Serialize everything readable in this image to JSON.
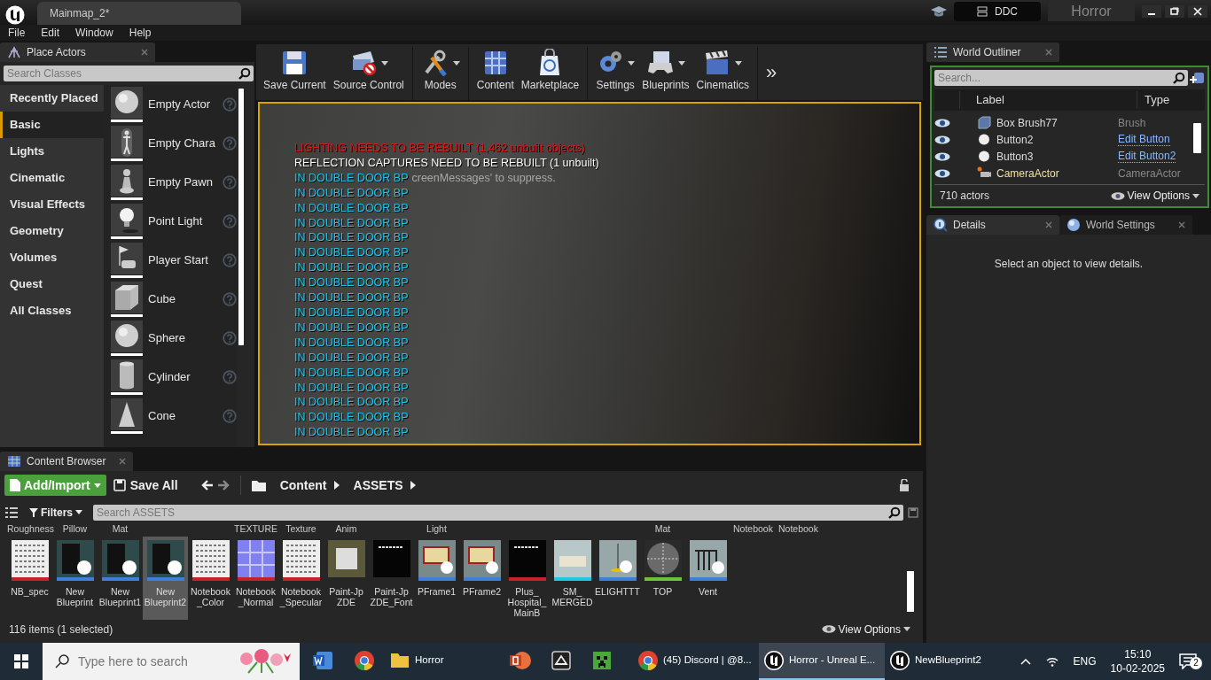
{
  "title_bar": {
    "tab": "Mainmap_2*",
    "ddc": "DDC",
    "project": "Horror"
  },
  "menu": [
    "File",
    "Edit",
    "Window",
    "Help"
  ],
  "place_actors": {
    "tab": "Place Actors",
    "search": {
      "placeholder": "Search Classes"
    },
    "categories": [
      {
        "label": "Recently Placed",
        "selected": false
      },
      {
        "label": "Basic",
        "selected": true
      },
      {
        "label": "Lights",
        "selected": false
      },
      {
        "label": "Cinematic",
        "selected": false
      },
      {
        "label": "Visual Effects",
        "selected": false
      },
      {
        "label": "Geometry",
        "selected": false
      },
      {
        "label": "Volumes",
        "selected": false
      },
      {
        "label": "Quest",
        "selected": false
      },
      {
        "label": "All Classes",
        "selected": false
      }
    ],
    "items": [
      {
        "label": "Empty Actor",
        "kind": "sphere"
      },
      {
        "label": "Empty Chara",
        "kind": "figure"
      },
      {
        "label": "Empty Pawn",
        "kind": "pawn"
      },
      {
        "label": "Point Light",
        "kind": "bulb"
      },
      {
        "label": "Player Start",
        "kind": "flag"
      },
      {
        "label": "Cube",
        "kind": "cube"
      },
      {
        "label": "Sphere",
        "kind": "sphere"
      },
      {
        "label": "Cylinder",
        "kind": "cylinder"
      },
      {
        "label": "Cone",
        "kind": "cone"
      }
    ]
  },
  "toolbar": {
    "buttons": [
      {
        "label": "Save Current",
        "kind": "save",
        "dropdown": false
      },
      {
        "label": "Source Control",
        "kind": "source",
        "dropdown": true
      },
      {
        "label": "Modes",
        "kind": "modes",
        "dropdown": true
      },
      {
        "label": "Content",
        "kind": "content",
        "dropdown": false
      },
      {
        "label": "Marketplace",
        "kind": "market",
        "dropdown": false
      },
      {
        "label": "Settings",
        "kind": "settings",
        "dropdown": true
      },
      {
        "label": "Blueprints",
        "kind": "blueprints",
        "dropdown": true
      },
      {
        "label": "Cinematics",
        "kind": "cinematics",
        "dropdown": true
      }
    ],
    "overflow": "»"
  },
  "viewport": {
    "warnings": [
      {
        "text": "LIGHTING NEEDS TO BE REBUILT (1,462 unbuilt objects)",
        "color": "#e01818"
      },
      {
        "text": "REFLECTION CAPTURES NEED TO BE REBUILT (1 unbuilt)",
        "color": "#ffffff"
      }
    ],
    "hint": "creenMessages' to suppress.",
    "messages": [
      "IN DOUBLE DOOR BP",
      "IN DOUBLE DOOR BP",
      "IN DOUBLE DOOR BP",
      "IN DOUBLE DOOR BP",
      "IN DOUBLE DOOR BP",
      "IN DOUBLE DOOR BP",
      "IN DOUBLE DOOR BP",
      "IN DOUBLE DOOR BP",
      "IN DOUBLE DOOR BP",
      "IN DOUBLE DOOR BP",
      "IN DOUBLE DOOR BP",
      "IN DOUBLE DOOR BP",
      "IN DOUBLE DOOR BP",
      "IN DOUBLE DOOR BP",
      "IN DOUBLE DOOR BP",
      "IN DOUBLE DOOR BP",
      "IN DOUBLE DOOR BP",
      "IN DOUBLE DOOR BP"
    ]
  },
  "world_outliner": {
    "tab": "World Outliner",
    "search": {
      "placeholder": "Search..."
    },
    "columns": [
      "Label",
      "Type"
    ],
    "rows": [
      {
        "label": "Box Brush77",
        "type": "Brush",
        "kind": "brush",
        "type_link": false,
        "highlighted": false
      },
      {
        "label": "Button2",
        "type": "Edit Button",
        "kind": "sphere",
        "type_link": true,
        "highlighted": false
      },
      {
        "label": "Button3",
        "type": "Edit Button2",
        "kind": "sphere",
        "type_link": true,
        "highlighted": false
      },
      {
        "label": "CameraActor",
        "type": "CameraActor",
        "kind": "camera",
        "type_link": false,
        "highlighted": true
      }
    ],
    "count": "710 actors",
    "view_options": "View Options"
  },
  "details": {
    "tabs": [
      {
        "label": "Details",
        "kind": "details",
        "selected": true
      },
      {
        "label": "World Settings",
        "kind": "world",
        "selected": false
      }
    ],
    "message": "Select an object to view details."
  },
  "content_browser": {
    "tab": "Content Browser",
    "add_import": "Add/Import",
    "save_all": "Save All",
    "path": [
      "Content",
      "ASSETS"
    ],
    "filters": "Filters",
    "search": {
      "placeholder": "Search ASSETS"
    },
    "upper_row": [
      {
        "kind": "label",
        "label": "Roughness"
      },
      {
        "kind": "label",
        "label": "Pillow"
      },
      {
        "kind": "label",
        "label": "Mat"
      },
      {
        "kind": "hidden"
      },
      {
        "kind": "hidden"
      },
      {
        "kind": "label",
        "label": "TEXTURE"
      },
      {
        "kind": "label",
        "label": "Texture"
      },
      {
        "kind": "label",
        "label": "Anim"
      },
      {
        "kind": "hidden"
      },
      {
        "kind": "label",
        "label": "Light"
      },
      {
        "kind": "hidden"
      },
      {
        "kind": "hidden"
      },
      {
        "kind": "hidden"
      },
      {
        "kind": "hidden"
      },
      {
        "kind": "label",
        "label": "Mat"
      },
      {
        "kind": "hidden"
      },
      {
        "kind": "label",
        "label": "Notebook"
      },
      {
        "kind": "label",
        "label": "Notebook"
      }
    ],
    "assets": [
      {
        "label": "NB_spec",
        "kind": "texture",
        "color": "#c4222a",
        "selected": false
      },
      {
        "label": "New Blueprint",
        "kind": "blueprint",
        "color": "#3d7fd9",
        "selected": false
      },
      {
        "label": "New Blueprint1",
        "kind": "blueprint",
        "color": "#3d7fd9",
        "selected": false
      },
      {
        "label": "New Blueprint2",
        "kind": "blueprint",
        "color": "#3d7fd9",
        "selected": true
      },
      {
        "label": "Notebook _Color",
        "kind": "texture",
        "color": "#c4222a",
        "selected": false
      },
      {
        "label": "Notebook _Normal",
        "kind": "normal",
        "color": "#c4222a",
        "selected": false
      },
      {
        "label": "Notebook _Specular",
        "kind": "texture",
        "color": "#c4222a",
        "selected": false
      },
      {
        "label": "Paint-Jp ZDE",
        "kind": "fontface",
        "selected": false
      },
      {
        "label": "Paint-Jp ZDE_Font",
        "kind": "font",
        "selected": false
      },
      {
        "label": "PFrame1",
        "kind": "frame",
        "color": "#3d7fd9",
        "selected": false
      },
      {
        "label": "PFrame2",
        "kind": "frame",
        "color": "#3d7fd9",
        "selected": false
      },
      {
        "label": "Plus_ Hospital_ MainB",
        "kind": "font",
        "color": "#c4222a",
        "selected": false
      },
      {
        "label": "SM_ MERGED",
        "kind": "mesh",
        "color": "#1ec8e0",
        "selected": false
      },
      {
        "label": "ELIGHTTT",
        "kind": "lamp",
        "color": "#3d7fd9",
        "selected": false
      },
      {
        "label": "TOP",
        "kind": "material",
        "color": "#6cc33a",
        "selected": false
      },
      {
        "label": "Vent",
        "kind": "vent",
        "color": "#3d7fd9",
        "selected": false
      }
    ],
    "status": "116 items (1 selected)",
    "view_options": "View Options"
  },
  "taskbar": {
    "search": {
      "placeholder": "Type here to search"
    },
    "apps": [
      {
        "kind": "word",
        "selected": false
      },
      {
        "kind": "chrome",
        "selected": false
      },
      {
        "kind": "folder",
        "label": "Horror",
        "selected": false
      },
      {
        "kind": "powerpoint",
        "selected": false
      },
      {
        "kind": "app",
        "selected": false
      },
      {
        "kind": "minecraft",
        "selected": false
      },
      {
        "kind": "chrome",
        "label": "(45) Discord | @8...",
        "selected": false
      },
      {
        "kind": "unreal",
        "label": "Horror - Unreal E...",
        "selected": true
      },
      {
        "kind": "unreal",
        "label": "NewBlueprint2",
        "selected": false
      }
    ],
    "language": "ENG",
    "time": "15:10",
    "date": "10-02-2025",
    "notifications": "2"
  }
}
